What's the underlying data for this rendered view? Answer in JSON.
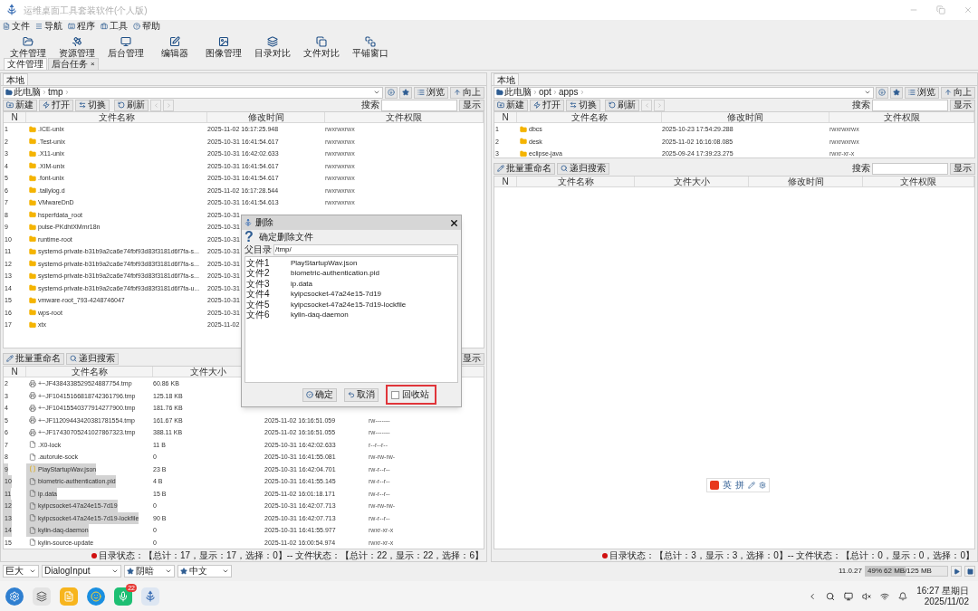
{
  "window": {
    "title": "运维桌面工具套装软件(个人版)"
  },
  "menu": [
    "文件",
    "导航",
    "程序",
    "工具",
    "帮助"
  ],
  "toolbar": [
    "文件管理",
    "资源管理",
    "后台管理",
    "编辑器",
    "图像管理",
    "目录对比",
    "文件对比",
    "平铺窗口"
  ],
  "doc_tabs": [
    {
      "label": "文件管理",
      "selected": true
    },
    {
      "label": "后台任务",
      "selected": false,
      "close": "×"
    }
  ],
  "left_panel": {
    "tab": "本地",
    "path": [
      "此电脑",
      "tmp"
    ],
    "view_button": "浏览",
    "up_button": "向上",
    "actions": [
      "新建",
      "打开",
      "切换",
      "刷新"
    ],
    "search_label": "搜索",
    "show_button": "显示",
    "dir_table": {
      "columns": [
        "N",
        "文件名称",
        "修改时间",
        "文件权限"
      ],
      "rows": [
        {
          "n": "1",
          "name": ".ICE-unix",
          "modified": "2025-11-02 16:17:25.948",
          "perms": "rwxrwxrwx"
        },
        {
          "n": "2",
          "name": ".Test-unix",
          "modified": "2025-10-31 16:41:54.617",
          "perms": "rwxrwxrwx"
        },
        {
          "n": "3",
          "name": ".X11-unix",
          "modified": "2025-10-31 16:42:02.633",
          "perms": "rwxrwxrwx"
        },
        {
          "n": "4",
          "name": ".XIM-unix",
          "modified": "2025-10-31 16:41:54.617",
          "perms": "rwxrwxrwx"
        },
        {
          "n": "5",
          "name": ".font-unix",
          "modified": "2025-10-31 16:41:54.617",
          "perms": "rwxrwxrwx"
        },
        {
          "n": "6",
          "name": ".tallylog.d",
          "modified": "2025-11-02 16:17:28.544",
          "perms": "rwxrwxrwx"
        },
        {
          "n": "7",
          "name": "VMwareDnD",
          "modified": "2025-10-31 16:41:54.613",
          "perms": "rwxrwxrwx"
        },
        {
          "n": "8",
          "name": "hsperfdata_root",
          "modified": "2025-10-31"
        },
        {
          "n": "9",
          "name": "pulse-PKdhtXMmr18n",
          "modified": "2025-10-31"
        },
        {
          "n": "10",
          "name": "runtime-root",
          "modified": "2025-10-31"
        },
        {
          "n": "11",
          "name": "systemd-private-b31b9a2ca6e74fbf93d83f3181d6f7fa-s...",
          "modified": "2025-10-31"
        },
        {
          "n": "12",
          "name": "systemd-private-b31b9a2ca6e74fbf93d83f3181d6f7fa-s...",
          "modified": "2025-10-31"
        },
        {
          "n": "13",
          "name": "systemd-private-b31b9a2ca6e74fbf93d83f3181d6f7fa-s...",
          "modified": "2025-10-31"
        },
        {
          "n": "14",
          "name": "systemd-private-b31b9a2ca6e74fbf93d83f3181d6f7fa-u...",
          "modified": "2025-10-31"
        },
        {
          "n": "15",
          "name": "vmware-root_793-4248746047",
          "modified": "2025-10-31"
        },
        {
          "n": "16",
          "name": "wps-root",
          "modified": "2025-10-31"
        },
        {
          "n": "17",
          "name": "xtx",
          "modified": "2025-11-02"
        }
      ]
    },
    "file_toolbar": [
      "批量重命名",
      "递归搜索"
    ],
    "file_show_button": "显示",
    "file_table": {
      "columns": [
        "N",
        "文件名称",
        "文件大小"
      ],
      "rows": [
        {
          "n": "2",
          "kind": "tmp",
          "name": "+~JF4384338529524887754.tmp",
          "size": "60.86 KB",
          "selected": false
        },
        {
          "n": "3",
          "kind": "tmp",
          "name": "+~JF10415166818742361796.tmp",
          "size": "125.18 KB",
          "selected": false
        },
        {
          "n": "4",
          "kind": "tmp",
          "name": "+~JF10415540377914277900.tmp",
          "size": "181.76 KB",
          "selected": false
        },
        {
          "n": "5",
          "kind": "tmp",
          "name": "+~JF11209443420381781554.tmp",
          "size": "161.67 KB",
          "modified": "2025-11-02 16:16:51.059",
          "perms": "rw-------",
          "selected": false
        },
        {
          "n": "6",
          "kind": "tmp",
          "name": "+~JF17430705241027867323.tmp",
          "size": "388.11 KB",
          "modified": "2025-11-02 16:16:51.055",
          "perms": "rw-------",
          "selected": false
        },
        {
          "n": "7",
          "kind": "file",
          "name": ".X0-lock",
          "size": "11 B",
          "modified": "2025-10-31 16:42:02.633",
          "perms": "r--r--r--",
          "selected": false
        },
        {
          "n": "8",
          "kind": "file",
          "name": ".autorule-sock",
          "size": "0",
          "modified": "2025-10-31 16:41:55.081",
          "perms": "rw-rw-rw-",
          "selected": false
        },
        {
          "n": "9",
          "kind": "json",
          "name": "PlayStartupWav.json",
          "size": "23 B",
          "modified": "2025-10-31 16:42:04.701",
          "perms": "rw-r--r--",
          "selected": true
        },
        {
          "n": "10",
          "kind": "file",
          "name": "biometric-authentication.pid",
          "size": "4 B",
          "modified": "2025-10-31 16:41:55.145",
          "perms": "rw-r--r--",
          "selected": true
        },
        {
          "n": "11",
          "kind": "file",
          "name": "ip.data",
          "size": "15 B",
          "modified": "2025-11-02 16:01:18.171",
          "perms": "rw-r--r--",
          "selected": true
        },
        {
          "n": "12",
          "kind": "file",
          "name": "kyipcsocket-47a24e15-7d19",
          "size": "0",
          "modified": "2025-10-31 16:42:07.713",
          "perms": "rw-rw-rw-",
          "selected": true
        },
        {
          "n": "13",
          "kind": "file",
          "name": "kyipcsocket-47a24e15-7d19-lockfile",
          "size": "90 B",
          "modified": "2025-10-31 16:42:07.713",
          "perms": "rw-r--r--",
          "selected": true
        },
        {
          "n": "14",
          "kind": "file",
          "name": "kylin-daq-daemon",
          "size": "0",
          "modified": "2025-10-31 16:41:55.977",
          "perms": "rwxr-xr-x",
          "selected": true
        },
        {
          "n": "15",
          "kind": "file",
          "name": "kylin-source-update",
          "size": "0",
          "modified": "2025-11-02 16:00:54.974",
          "perms": "rwxr-xr-x",
          "selected": false
        }
      ]
    },
    "status": "目录状态：【总计：17，显示：17，选择：0】-- 文件状态：【总计：22，显示：22，选择：6】"
  },
  "right_panel": {
    "tab": "本地",
    "path": [
      "此电脑",
      "opt",
      "apps"
    ],
    "view_button": "浏览",
    "up_button": "向上",
    "actions": [
      "新建",
      "打开",
      "切换",
      "刷新"
    ],
    "search_label": "搜索",
    "show_button": "显示",
    "dir_table": {
      "columns": [
        "N",
        "文件名称",
        "修改时间",
        "文件权限"
      ],
      "rows": [
        {
          "n": "1",
          "name": "dbcs",
          "modified": "2025-10-23 17:54:29.288",
          "perms": "rwxrwxrwx"
        },
        {
          "n": "2",
          "name": "desk",
          "modified": "2025-11-02 16:16:08.085",
          "perms": "rwxrwxrwx"
        },
        {
          "n": "3",
          "name": "eclipse-java",
          "modified": "2025-09-24 17:39:23.275",
          "perms": "rwxr-xr-x"
        }
      ]
    },
    "file_toolbar": [
      "批量重命名",
      "递归搜索"
    ],
    "file_search_label": "搜索",
    "file_show_button": "显示",
    "file_table": {
      "columns": [
        "N",
        "文件名称",
        "文件大小",
        "修改时间",
        "文件权限"
      ]
    },
    "status": "目录状态：【总计：3，显示：3，选择：0】-- 文件状态：【总计：0，显示：0，选择：0】"
  },
  "ime_bar": [
    "英",
    "拼"
  ],
  "dialog": {
    "title": "删除",
    "question_mark": "?",
    "message": "确定删除文件",
    "dir_label": "父目录",
    "dir_value": "/tmp/",
    "files": [
      {
        "label": "文件1",
        "name": "PlayStartupWav.json"
      },
      {
        "label": "文件2",
        "name": "biometric-authentication.pid"
      },
      {
        "label": "文件3",
        "name": "ip.data"
      },
      {
        "label": "文件4",
        "name": "kyipcsocket-47a24e15-7d19"
      },
      {
        "label": "文件5",
        "name": "kyipcsocket-47a24e15-7d19-lockfile"
      },
      {
        "label": "文件6",
        "name": "kylin-daq-daemon"
      }
    ],
    "ok": "确定",
    "cancel": "取消",
    "recycle": {
      "label": "回收站",
      "checked": false,
      "highlighted": true
    }
  },
  "bottom_bar": {
    "font_size": "巨大",
    "font": "DialogInput",
    "theme": "阴暗",
    "language": "中文",
    "version": "11.0.27",
    "memory": {
      "level": 0.49,
      "percent": "49%",
      "reading": "62 MB/125 MB"
    }
  },
  "taskbar": {
    "badge": "22",
    "time": "16:27 星期日",
    "date": "2025/11/02"
  }
}
